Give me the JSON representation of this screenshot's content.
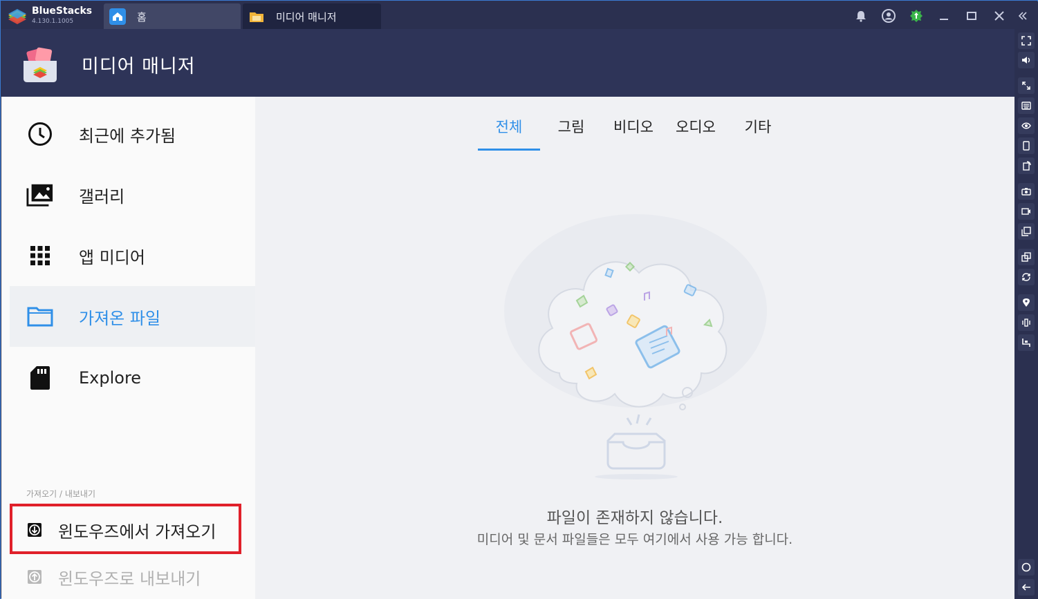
{
  "titlebar": {
    "brand_name": "BlueStacks",
    "brand_version": "4.130.1.1005",
    "tabs": [
      {
        "label": "홈"
      },
      {
        "label": "미디어 매니저"
      }
    ],
    "icons": [
      "bell-icon",
      "account-icon",
      "update-icon",
      "minimize-icon",
      "maximize-icon",
      "close-icon",
      "collapse-icon"
    ]
  },
  "header": {
    "title": "미디어 매니저"
  },
  "sidebar": {
    "items": [
      {
        "label": "최근에 추가됨",
        "icon": "clock-icon"
      },
      {
        "label": "갤러리",
        "icon": "gallery-icon"
      },
      {
        "label": "앱 미디어",
        "icon": "grid-icon"
      },
      {
        "label": "가져온 파일",
        "icon": "folder-icon",
        "active": true
      },
      {
        "label": "Explore",
        "icon": "sd-card-icon"
      }
    ],
    "section_label": "가져오기 / 내보내기",
    "import_label": "윈도우즈에서 가져오기",
    "export_label": "윈도우즈로 내보내기"
  },
  "main": {
    "tabs": [
      {
        "label": "전체",
        "active": true
      },
      {
        "label": "그림"
      },
      {
        "label": "비디오"
      },
      {
        "label": "오디오"
      },
      {
        "label": "기타"
      }
    ],
    "empty_title": "파일이 존재하지 않습니다.",
    "empty_subtitle": "미디어 및 문서 파일들은 모두 여기에서 사용 가능 합니다."
  },
  "colors": {
    "accent": "#2f8fe8",
    "header_bg": "#2e3458",
    "titlebar_bg": "#2b3050",
    "highlight_border": "#e0202a"
  }
}
